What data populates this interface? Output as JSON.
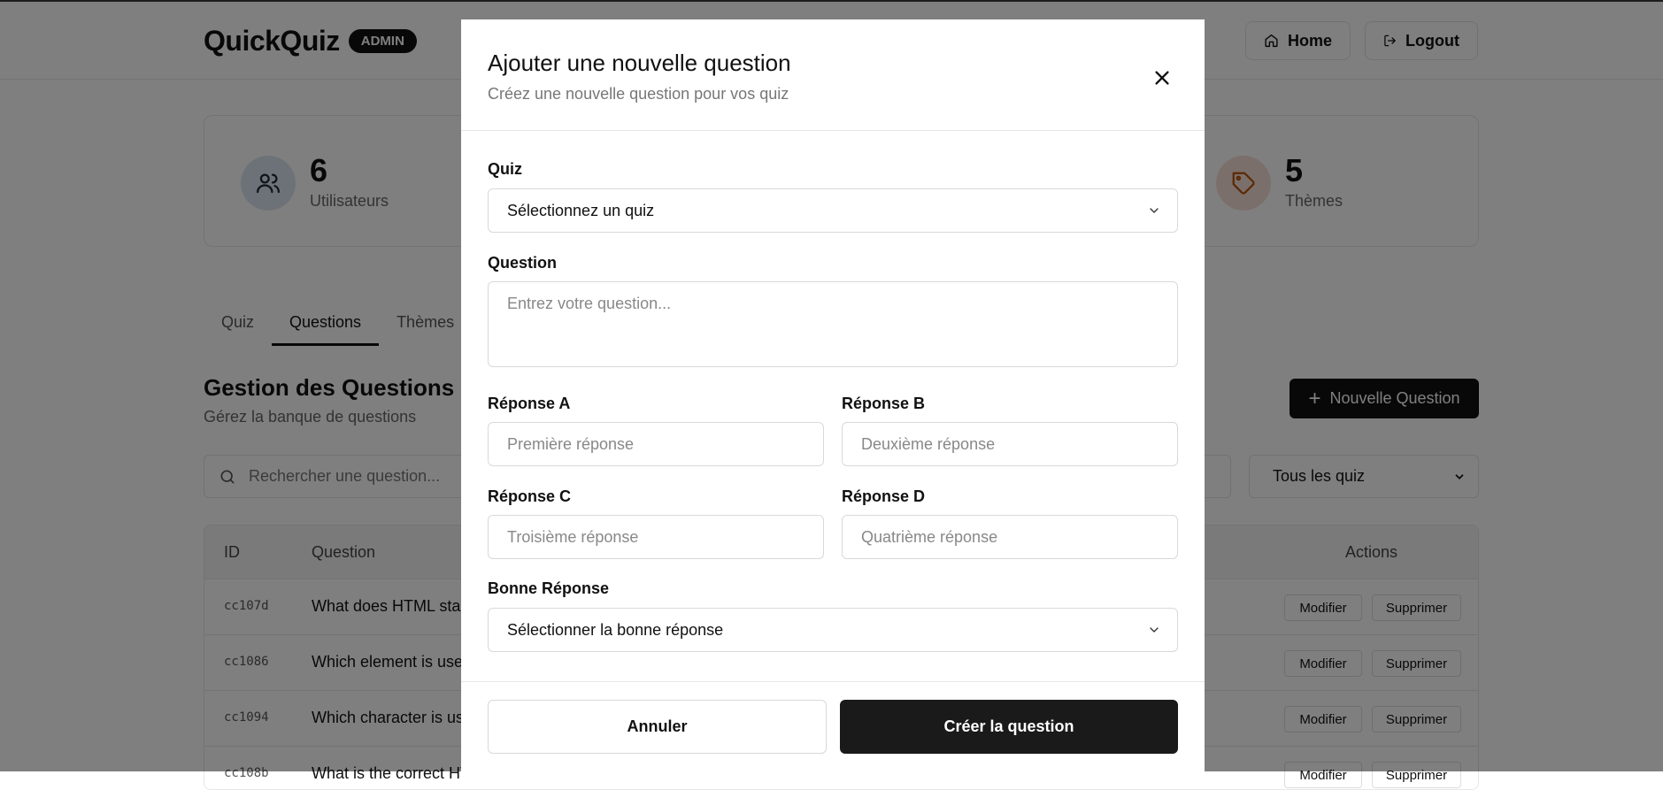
{
  "header": {
    "brand": "QuickQuiz",
    "badge": "ADMIN",
    "home_label": "Home",
    "logout_label": "Logout"
  },
  "stats": [
    {
      "value": "6",
      "label": "Utilisateurs",
      "icon": "users-icon",
      "color": "#dbe4f0"
    },
    {
      "value": "5",
      "label": "Thèmes",
      "icon": "tag-icon",
      "color": "#f6dfd6"
    }
  ],
  "tabs": [
    {
      "label": "Quiz"
    },
    {
      "label": "Questions",
      "active": true
    },
    {
      "label": "Thèmes"
    }
  ],
  "section": {
    "title": "Gestion des Questions",
    "subtitle": "Gérez la banque de questions",
    "new_button": "Nouvelle Question",
    "search_placeholder": "Rechercher une question...",
    "filter_value": "Tous les quiz"
  },
  "table": {
    "columns": {
      "id": "ID",
      "question": "Question",
      "actions": "Actions"
    },
    "rows": [
      {
        "id": "cc107d",
        "question": "What does HTML stan"
      },
      {
        "id": "cc1086",
        "question": "Which element is used"
      },
      {
        "id": "cc1094",
        "question": "Which character is use"
      },
      {
        "id": "cc108b",
        "question": "What is the correct HT"
      }
    ],
    "edit_label": "Modifier",
    "delete_label": "Supprimer"
  },
  "modal": {
    "title": "Ajouter une nouvelle question",
    "subtitle": "Créez une nouvelle question pour vos quiz",
    "quiz_label": "Quiz",
    "quiz_value": "Sélectionnez un quiz",
    "question_label": "Question",
    "question_placeholder": "Entrez votre question...",
    "answer_a_label": "Réponse A",
    "answer_a_placeholder": "Première réponse",
    "answer_b_label": "Réponse B",
    "answer_b_placeholder": "Deuxième réponse",
    "answer_c_label": "Réponse C",
    "answer_c_placeholder": "Troisième réponse",
    "answer_d_label": "Réponse D",
    "answer_d_placeholder": "Quatrième réponse",
    "correct_label": "Bonne Réponse",
    "correct_value": "Sélectionner la bonne réponse",
    "cancel_label": "Annuler",
    "create_label": "Créer la question"
  },
  "colors": {
    "overlay": "rgba(0,0,0,0.5)",
    "primary": "#1a1a1a"
  }
}
